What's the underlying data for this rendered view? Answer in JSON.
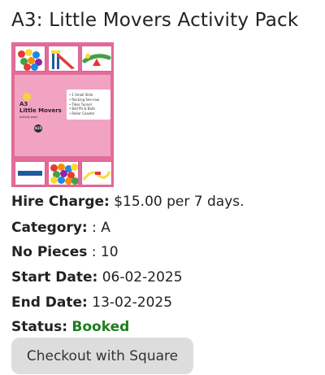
{
  "product": {
    "title": "A3: Little Movers Activity Pack",
    "image": {
      "brand_colors": {
        "pink": "#e36c9a",
        "light_pink": "#f2a3c2",
        "blue": "#1f5b9c",
        "yellow": "#f7d23a",
        "green": "#1e7d1e"
      },
      "logo_line1": "A3",
      "logo_line2": "Little Movers",
      "logo_tagline": "activity pack",
      "badge": "$15",
      "list_items": [
        "1 Small Slide",
        "Rocking See-saw",
        "Tikes Tunnel",
        "Ball Pit & Balls",
        "Roller Coaster"
      ]
    }
  },
  "details": {
    "hire_charge_label": "Hire Charge:",
    "hire_charge_value": "$15.00 per 7 days.",
    "category_label": "Category:",
    "category_value": ": A",
    "pieces_label": "No Pieces",
    "pieces_value": ": 10",
    "start_label": "Start Date:",
    "start_value": "06-02-2025",
    "end_label": "End Date:",
    "end_value": "13-02-2025",
    "status_label": "Status:",
    "status_value": "Booked"
  },
  "actions": {
    "checkout_label": "Checkout with Square"
  }
}
